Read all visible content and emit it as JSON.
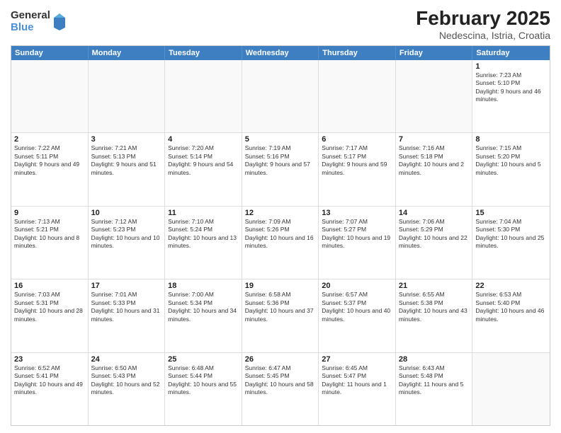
{
  "header": {
    "logo_general": "General",
    "logo_blue": "Blue",
    "main_title": "February 2025",
    "subtitle": "Nedescina, Istria, Croatia"
  },
  "calendar": {
    "weekdays": [
      "Sunday",
      "Monday",
      "Tuesday",
      "Wednesday",
      "Thursday",
      "Friday",
      "Saturday"
    ],
    "rows": [
      [
        {
          "day": "",
          "info": "",
          "empty": true
        },
        {
          "day": "",
          "info": "",
          "empty": true
        },
        {
          "day": "",
          "info": "",
          "empty": true
        },
        {
          "day": "",
          "info": "",
          "empty": true
        },
        {
          "day": "",
          "info": "",
          "empty": true
        },
        {
          "day": "",
          "info": "",
          "empty": true
        },
        {
          "day": "1",
          "info": "Sunrise: 7:23 AM\nSunset: 5:10 PM\nDaylight: 9 hours and 46 minutes."
        }
      ],
      [
        {
          "day": "2",
          "info": "Sunrise: 7:22 AM\nSunset: 5:11 PM\nDaylight: 9 hours and 49 minutes."
        },
        {
          "day": "3",
          "info": "Sunrise: 7:21 AM\nSunset: 5:13 PM\nDaylight: 9 hours and 51 minutes."
        },
        {
          "day": "4",
          "info": "Sunrise: 7:20 AM\nSunset: 5:14 PM\nDaylight: 9 hours and 54 minutes."
        },
        {
          "day": "5",
          "info": "Sunrise: 7:19 AM\nSunset: 5:16 PM\nDaylight: 9 hours and 57 minutes."
        },
        {
          "day": "6",
          "info": "Sunrise: 7:17 AM\nSunset: 5:17 PM\nDaylight: 9 hours and 59 minutes."
        },
        {
          "day": "7",
          "info": "Sunrise: 7:16 AM\nSunset: 5:18 PM\nDaylight: 10 hours and 2 minutes."
        },
        {
          "day": "8",
          "info": "Sunrise: 7:15 AM\nSunset: 5:20 PM\nDaylight: 10 hours and 5 minutes."
        }
      ],
      [
        {
          "day": "9",
          "info": "Sunrise: 7:13 AM\nSunset: 5:21 PM\nDaylight: 10 hours and 8 minutes."
        },
        {
          "day": "10",
          "info": "Sunrise: 7:12 AM\nSunset: 5:23 PM\nDaylight: 10 hours and 10 minutes."
        },
        {
          "day": "11",
          "info": "Sunrise: 7:10 AM\nSunset: 5:24 PM\nDaylight: 10 hours and 13 minutes."
        },
        {
          "day": "12",
          "info": "Sunrise: 7:09 AM\nSunset: 5:26 PM\nDaylight: 10 hours and 16 minutes."
        },
        {
          "day": "13",
          "info": "Sunrise: 7:07 AM\nSunset: 5:27 PM\nDaylight: 10 hours and 19 minutes."
        },
        {
          "day": "14",
          "info": "Sunrise: 7:06 AM\nSunset: 5:29 PM\nDaylight: 10 hours and 22 minutes."
        },
        {
          "day": "15",
          "info": "Sunrise: 7:04 AM\nSunset: 5:30 PM\nDaylight: 10 hours and 25 minutes."
        }
      ],
      [
        {
          "day": "16",
          "info": "Sunrise: 7:03 AM\nSunset: 5:31 PM\nDaylight: 10 hours and 28 minutes."
        },
        {
          "day": "17",
          "info": "Sunrise: 7:01 AM\nSunset: 5:33 PM\nDaylight: 10 hours and 31 minutes."
        },
        {
          "day": "18",
          "info": "Sunrise: 7:00 AM\nSunset: 5:34 PM\nDaylight: 10 hours and 34 minutes."
        },
        {
          "day": "19",
          "info": "Sunrise: 6:58 AM\nSunset: 5:36 PM\nDaylight: 10 hours and 37 minutes."
        },
        {
          "day": "20",
          "info": "Sunrise: 6:57 AM\nSunset: 5:37 PM\nDaylight: 10 hours and 40 minutes."
        },
        {
          "day": "21",
          "info": "Sunrise: 6:55 AM\nSunset: 5:38 PM\nDaylight: 10 hours and 43 minutes."
        },
        {
          "day": "22",
          "info": "Sunrise: 6:53 AM\nSunset: 5:40 PM\nDaylight: 10 hours and 46 minutes."
        }
      ],
      [
        {
          "day": "23",
          "info": "Sunrise: 6:52 AM\nSunset: 5:41 PM\nDaylight: 10 hours and 49 minutes."
        },
        {
          "day": "24",
          "info": "Sunrise: 6:50 AM\nSunset: 5:43 PM\nDaylight: 10 hours and 52 minutes."
        },
        {
          "day": "25",
          "info": "Sunrise: 6:48 AM\nSunset: 5:44 PM\nDaylight: 10 hours and 55 minutes."
        },
        {
          "day": "26",
          "info": "Sunrise: 6:47 AM\nSunset: 5:45 PM\nDaylight: 10 hours and 58 minutes."
        },
        {
          "day": "27",
          "info": "Sunrise: 6:45 AM\nSunset: 5:47 PM\nDaylight: 11 hours and 1 minute."
        },
        {
          "day": "28",
          "info": "Sunrise: 6:43 AM\nSunset: 5:48 PM\nDaylight: 11 hours and 5 minutes."
        },
        {
          "day": "",
          "info": "",
          "empty": true
        }
      ]
    ]
  }
}
